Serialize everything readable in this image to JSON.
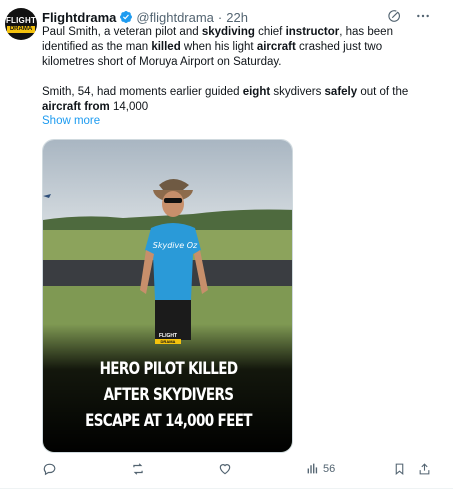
{
  "author": {
    "display_name": "Flightdrama",
    "handle": "@flightdrama",
    "separator": "·",
    "time": "22h",
    "avatar_line1": "FLIGHT",
    "avatar_line2": "DRAMA"
  },
  "tweet": {
    "p1": [
      {
        "t": "Paul Smith, a veteran pilot and ",
        "b": false
      },
      {
        "t": "skydiving",
        "b": true
      },
      {
        "t": " chief ",
        "b": false
      },
      {
        "t": "instructor",
        "b": true
      },
      {
        "t": ", has been identified as the man ",
        "b": false
      },
      {
        "t": "killed",
        "b": true
      },
      {
        "t": " when his light ",
        "b": false
      },
      {
        "t": "aircraft",
        "b": true
      },
      {
        "t": " crashed just two kilometres short of Moruya Airport on Saturday.",
        "b": false
      }
    ],
    "p2": [
      {
        "t": "Smith, 54, had moments earlier guided ",
        "b": false
      },
      {
        "t": "eight",
        "b": true
      },
      {
        "t": " skydivers ",
        "b": false
      },
      {
        "t": "safely",
        "b": true
      },
      {
        "t": " out of the ",
        "b": false
      },
      {
        "t": "aircraft",
        "b": true
      },
      {
        "t": " ",
        "b": false
      },
      {
        "t": "from",
        "b": true
      },
      {
        "t": " 14,000",
        "b": false
      }
    ],
    "show_more": "Show more"
  },
  "media": {
    "badge_line1": "FLIGHT",
    "badge_line2": "DRAMA",
    "shirt_text": "Skydive Oz",
    "headline_lines": [
      "HERO PILOT KILLED",
      "AFTER SKYDIVERS",
      "ESCAPE AT 14,000 FEET"
    ]
  },
  "actions": {
    "reply_count": "",
    "repost_count": "",
    "like_count": "",
    "views_count": "56"
  },
  "colors": {
    "accent": "#1d9bf0",
    "muted": "#536471",
    "brand_yellow": "#f4c20d"
  },
  "icons": [
    "verified-badge-icon",
    "grok-icon",
    "more-icon",
    "reply-icon",
    "repost-icon",
    "like-icon",
    "views-icon",
    "bookmark-icon",
    "share-icon"
  ]
}
